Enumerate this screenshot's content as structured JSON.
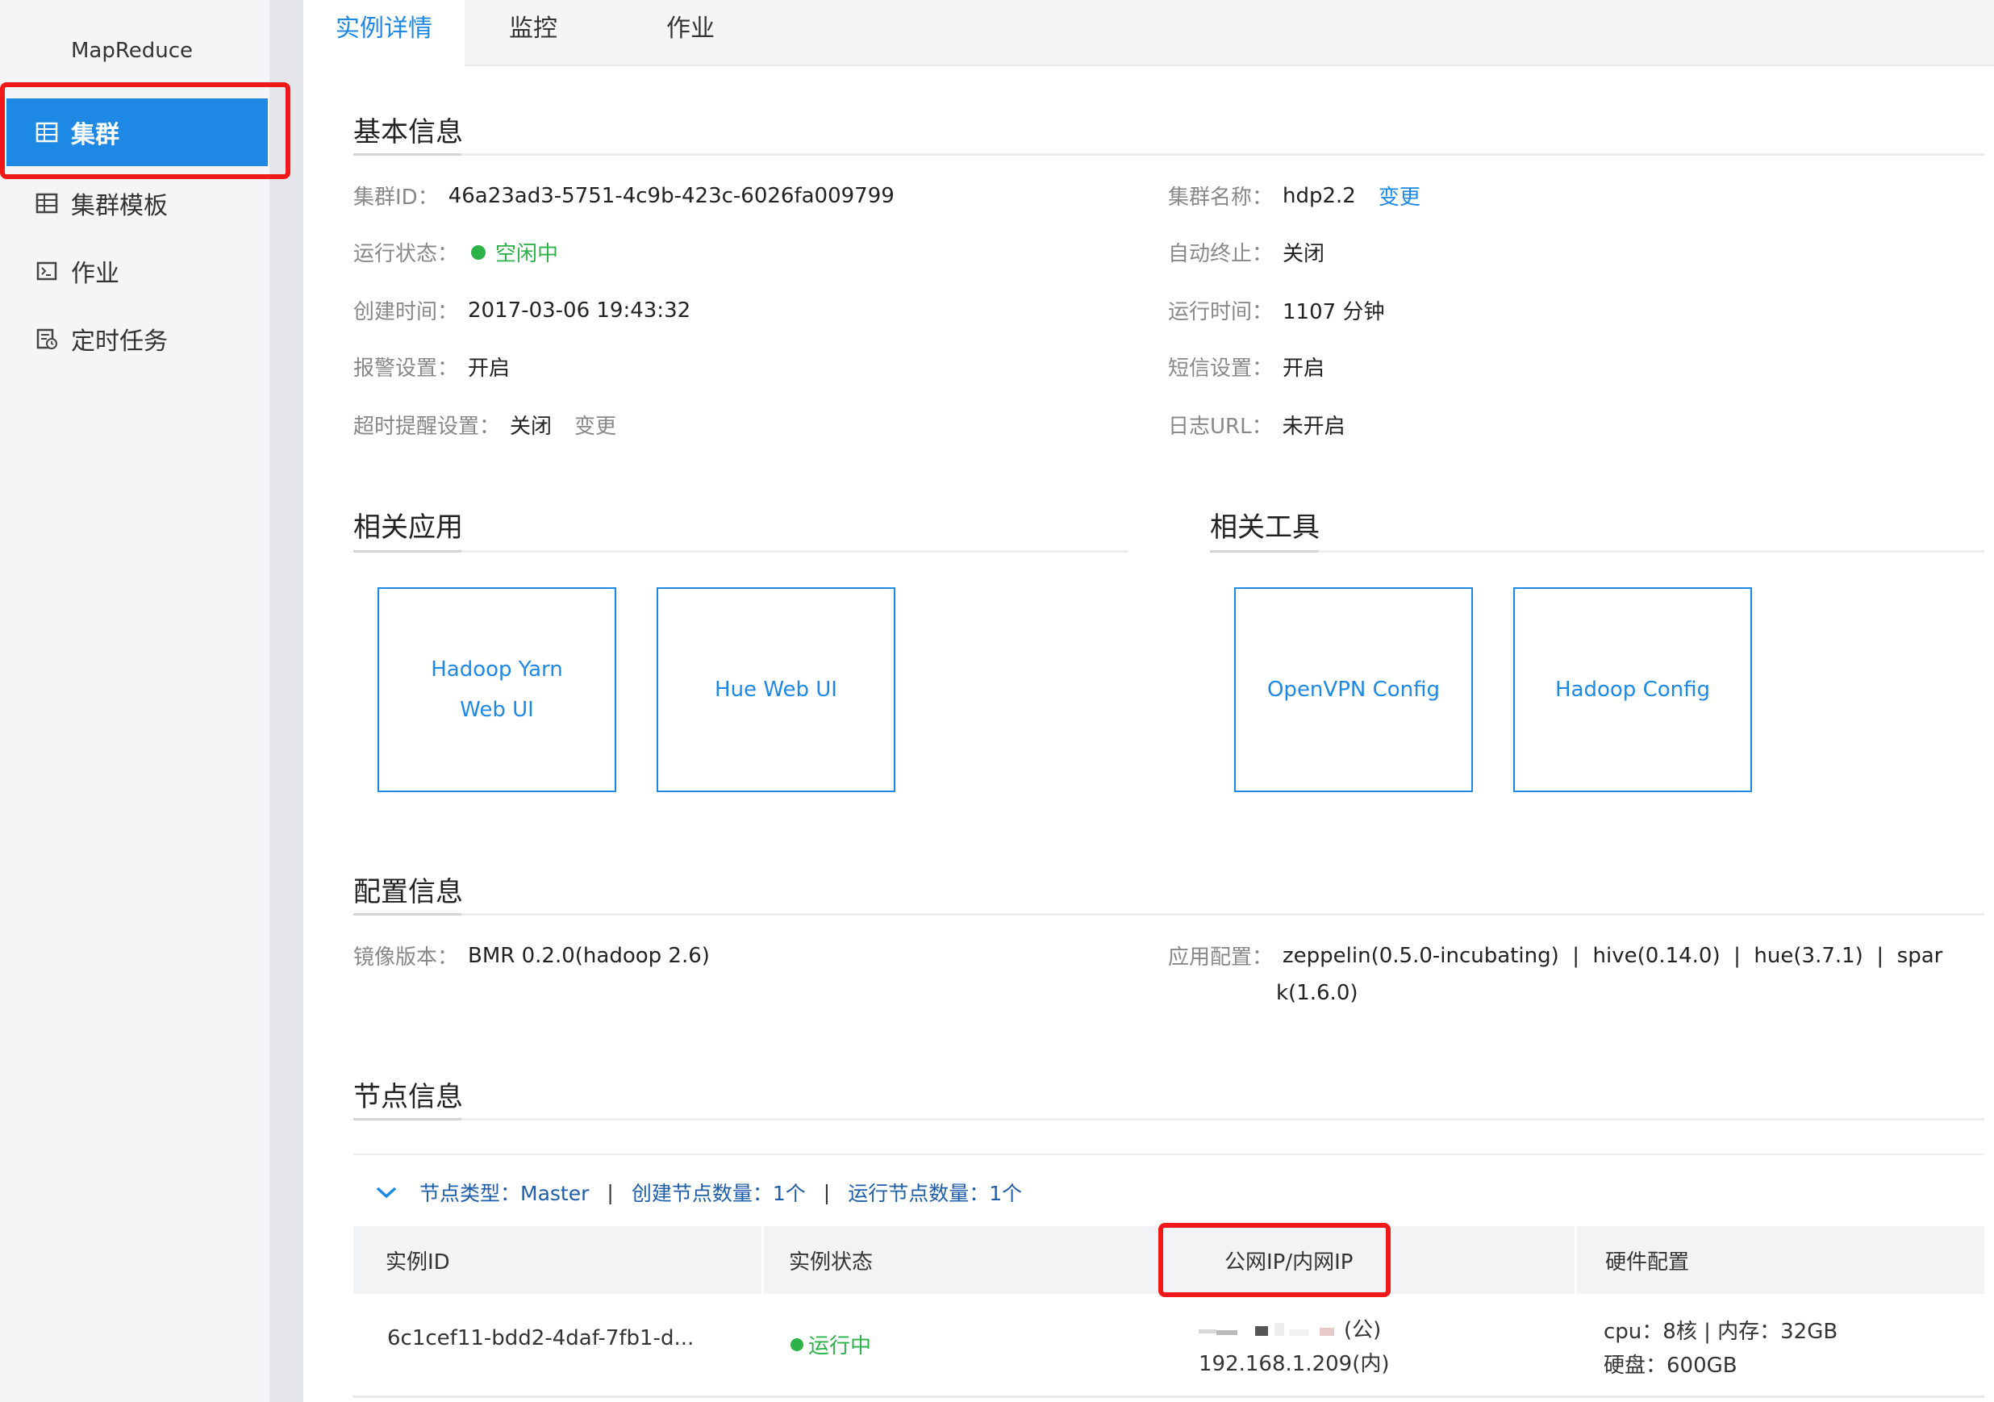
{
  "sidebar": {
    "brand": "MapReduce",
    "items": [
      {
        "label": "集群",
        "icon": "cluster-icon",
        "active": true
      },
      {
        "label": "集群模板",
        "icon": "template-icon",
        "active": false
      },
      {
        "label": "作业",
        "icon": "terminal-icon",
        "active": false
      },
      {
        "label": "定时任务",
        "icon": "schedule-icon",
        "active": false
      }
    ]
  },
  "tabs": [
    {
      "label": "实例详情",
      "active": true
    },
    {
      "label": "监控",
      "active": false
    },
    {
      "label": "作业",
      "active": false
    }
  ],
  "basic_info": {
    "title": "基本信息",
    "cluster_id_label": "集群ID：",
    "cluster_id": "46a23ad3-5751-4c9b-423c-6026fa009799",
    "cluster_name_label": "集群名称：",
    "cluster_name": "hdp2.2",
    "change_link": "变更",
    "status_label": "运行状态：",
    "status_value": "空闲中",
    "auto_stop_label": "自动终止：",
    "auto_stop_value": "关闭",
    "create_time_label": "创建时间：",
    "create_time_value": "2017-03-06 19:43:32",
    "run_time_label": "运行时间：",
    "run_time_value": "1107 分钟",
    "alarm_label": "报警设置：",
    "alarm_value": "开启",
    "sms_label": "短信设置：",
    "sms_value": "开启",
    "timeout_label": "超时提醒设置：",
    "timeout_value": "关闭",
    "timeout_change": "变更",
    "log_label": "日志URL：",
    "log_value": "未开启"
  },
  "apps": {
    "title": "相关应用",
    "items": [
      {
        "line1": "Hadoop Yarn",
        "line2": "Web UI"
      },
      {
        "line1": "Hue Web UI",
        "line2": ""
      }
    ]
  },
  "tools": {
    "title": "相关工具",
    "items": [
      {
        "line1": "OpenVPN Config"
      },
      {
        "line1": "Hadoop Config"
      }
    ]
  },
  "config_info": {
    "title": "配置信息",
    "image_label": "镜像版本：",
    "image_value": "BMR 0.2.0(hadoop 2.6)",
    "app_label": "应用配置：",
    "app_value_line1": "zeppelin(0.5.0-incubating)  |  hive(0.14.0)  |  hue(3.7.1)  |  spar",
    "app_value_line2": "k(1.6.0)"
  },
  "node_info": {
    "title": "节点信息",
    "node_type": "节点类型：Master",
    "sep": "|",
    "create_count": "创建节点数量：1个",
    "run_count": "运行节点数量：1个",
    "columns": [
      "实例ID",
      "实例状态",
      "公网IP/内网IP",
      "硬件配置"
    ],
    "row": {
      "instance_id": "6c1cef11-bdd2-4daf-7fb1-d...",
      "status": "运行中",
      "public_ip_suffix": "(公)",
      "private_ip": "192.168.1.209(内)",
      "hw_line1": "cpu：8核 | 内存：32GB",
      "hw_line2": "硬盘：600GB"
    }
  },
  "colors": {
    "accent": "#1e88e5",
    "highlight": "#f01818",
    "success": "#2db24a"
  }
}
